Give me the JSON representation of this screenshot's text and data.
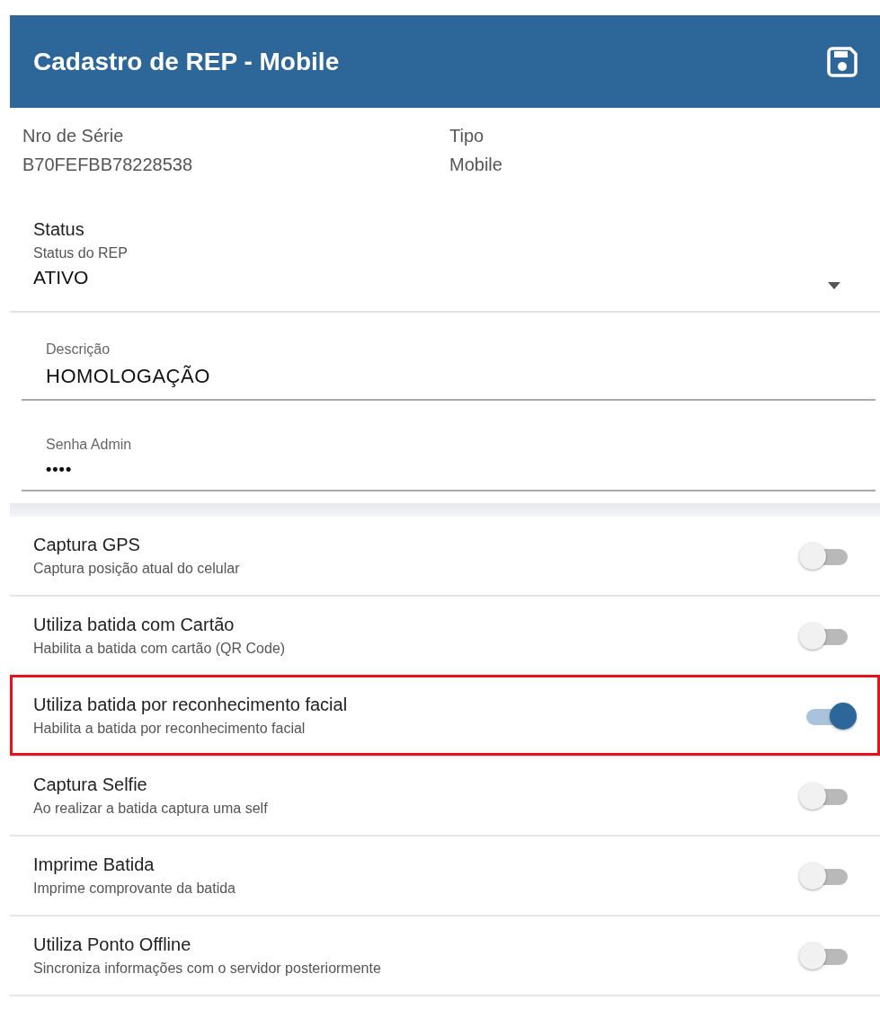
{
  "header": {
    "title": "Cadastro de REP - Mobile"
  },
  "info": [
    {
      "label": "Nro de Série",
      "value": "B70FEFBB78228538"
    },
    {
      "label": "Tipo",
      "value": "Mobile"
    }
  ],
  "status": {
    "title": "Status",
    "label": "Status do REP",
    "value": "ATIVO"
  },
  "fields": [
    {
      "kind": "text",
      "label": "Descrição",
      "value": "HOMOLOGAÇÃO"
    },
    {
      "kind": "password",
      "label": "Senha Admin",
      "value": "••••"
    }
  ],
  "settings": [
    {
      "title": "Captura GPS",
      "description": "Captura posição atual do celular",
      "on": false,
      "highlighted": false
    },
    {
      "title": "Utiliza batida com Cartão",
      "description": "Habilita a batida com cartão (QR Code)",
      "on": false,
      "highlighted": false
    },
    {
      "title": "Utiliza batida por reconhecimento facial",
      "description": "Habilita a batida por reconhecimento facial",
      "on": true,
      "highlighted": true
    },
    {
      "title": "Captura Selfie",
      "description": "Ao realizar a batida captura uma self",
      "on": false,
      "highlighted": false
    },
    {
      "title": "Imprime Batida",
      "description": "Imprime comprovante da batida",
      "on": false,
      "highlighted": false
    },
    {
      "title": "Utiliza Ponto Offline",
      "description": "Sincroniza informações com o servidor posteriormente",
      "on": false,
      "highlighted": false
    }
  ]
}
